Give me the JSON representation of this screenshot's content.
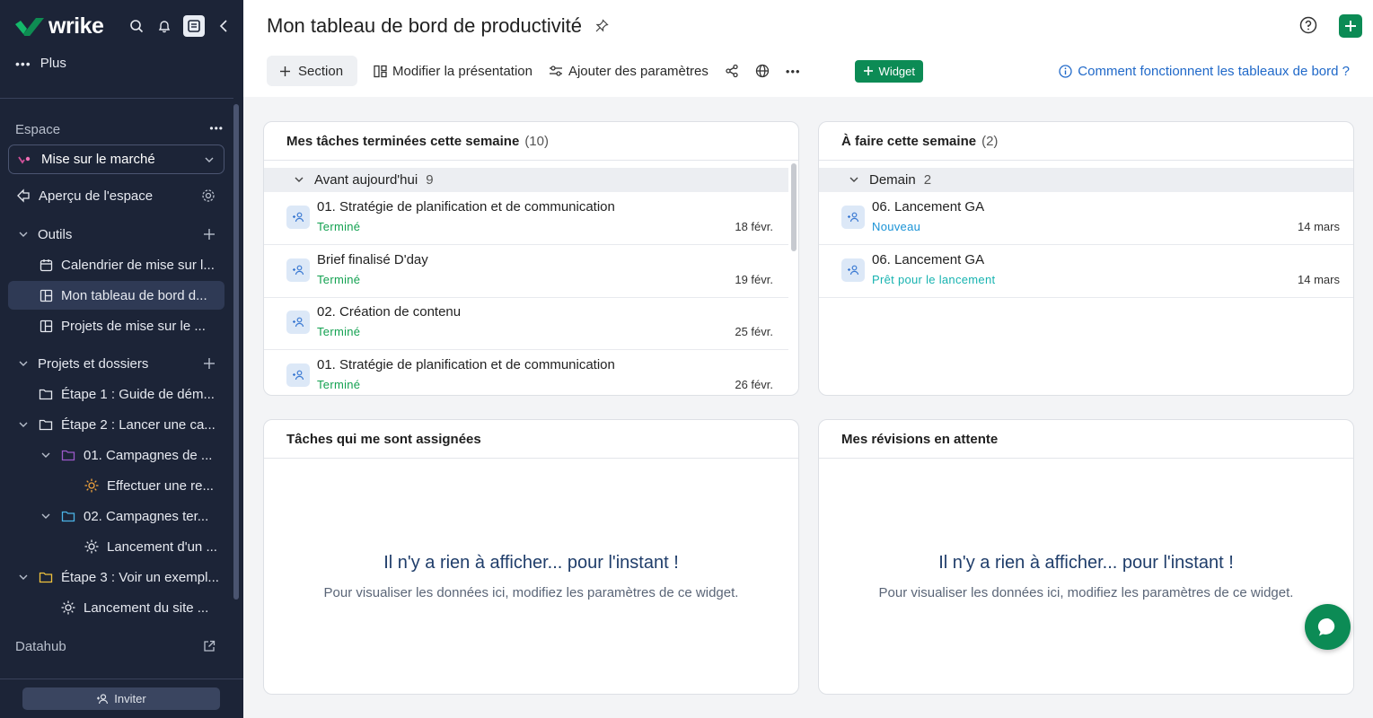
{
  "sidebar": {
    "logo": "wrike",
    "plus_label": "Plus",
    "space_label": "Espace",
    "space_selected": "Mise sur le marché",
    "items": [
      {
        "label": "Aperçu de l'espace"
      },
      {
        "label": "Outils"
      },
      {
        "label": "Calendrier de mise sur l..."
      },
      {
        "label": "Mon tableau de bord d..."
      },
      {
        "label": "Projets de mise sur le ..."
      },
      {
        "label": "Projets et dossiers"
      },
      {
        "label": "Étape 1 : Guide de dém..."
      },
      {
        "label": "Étape 2 : Lancer une ca..."
      },
      {
        "label": "01. Campagnes de ..."
      },
      {
        "label": "Effectuer une re..."
      },
      {
        "label": "02. Campagnes ter..."
      },
      {
        "label": "Lancement d'un ..."
      },
      {
        "label": "Étape 3 : Voir un exempl..."
      },
      {
        "label": "Lancement du site ..."
      },
      {
        "label": "Datahub"
      }
    ],
    "invite_label": "Inviter"
  },
  "header": {
    "title": "Mon tableau de bord de productivité",
    "toolbar": {
      "section_label": "Section",
      "edit_layout_label": "Modifier la présentation",
      "add_params_label": "Ajouter des paramètres",
      "widget_label": "Widget",
      "help_link": "Comment fonctionnent les tableaux de bord ?"
    }
  },
  "widgets": {
    "done_week": {
      "title": "Mes tâches terminées cette semaine",
      "count": "(10)",
      "group_label": "Avant aujourd'hui",
      "group_count": "9",
      "tasks": [
        {
          "name": "01. Stratégie de planification et de communication",
          "status": "Terminé",
          "date": "18 févr."
        },
        {
          "name": "Brief finalisé D'day",
          "status": "Terminé",
          "date": "19 févr."
        },
        {
          "name": "02. Création de contenu",
          "status": "Terminé",
          "date": "25 févr."
        },
        {
          "name": "01. Stratégie de planification et de communication",
          "status": "Terminé",
          "date": "26 févr."
        }
      ]
    },
    "todo_week": {
      "title": "À faire cette semaine",
      "count": "(2)",
      "group_label": "Demain",
      "group_count": "2",
      "tasks": [
        {
          "name": "06. Lancement GA",
          "status": "Nouveau",
          "date": "14 mars"
        },
        {
          "name": "06. Lancement GA",
          "status": "Prêt pour le lancement",
          "date": "14 mars"
        }
      ]
    },
    "assigned": {
      "title": "Tâches qui me sont assignées",
      "empty_title": "Il n'y a rien à afficher... pour l'instant !",
      "empty_sub": "Pour visualiser les données ici, modifiez les paramètres de ce widget."
    },
    "reviews": {
      "title": "Mes révisions en attente",
      "empty_title": "Il n'y a rien à afficher... pour l'instant !",
      "empty_sub": "Pour visualiser les données ici, modifiez les paramètres de ce widget."
    }
  },
  "colors": {
    "sidebar_bg": "#1c2437",
    "accent_green": "#0c8b55",
    "status_done": "#12a150",
    "status_new": "#1b93d6",
    "status_ready": "#17b3b0",
    "link_blue": "#2069c9"
  }
}
